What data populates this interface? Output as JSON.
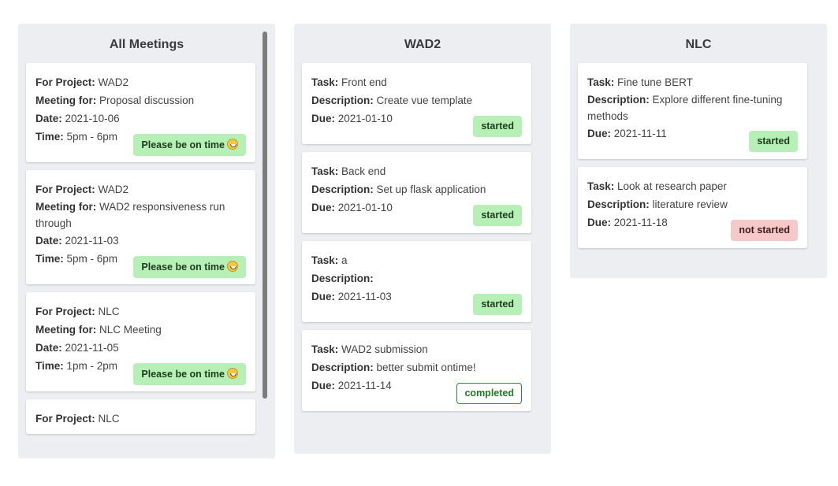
{
  "columns": {
    "meetings": {
      "title": "All Meetings",
      "labels": {
        "project": "For Project:",
        "meeting": "Meeting for:",
        "date": "Date:",
        "time": "Time:"
      },
      "badge_label": "Please be on time",
      "items": [
        {
          "project": "WAD2",
          "meeting": "Proposal discussion",
          "date": "2021-10-06",
          "time": "5pm - 6pm"
        },
        {
          "project": "WAD2",
          "meeting": "WAD2 responsiveness run through",
          "date": "2021-11-03",
          "time": "5pm - 6pm"
        },
        {
          "project": "NLC",
          "meeting": "NLC Meeting",
          "date": "2021-11-05",
          "time": "1pm - 2pm"
        },
        {
          "project": "NLC"
        }
      ]
    },
    "wad2": {
      "title": "WAD2",
      "labels": {
        "task": "Task:",
        "description": "Description:",
        "due": "Due:"
      },
      "items": [
        {
          "task": "Front end",
          "description": "Create vue template",
          "due": "2021-01-10",
          "status": "started"
        },
        {
          "task": "Back end",
          "description": "Set up flask application",
          "due": "2021-01-10",
          "status": "started"
        },
        {
          "task": "a",
          "description": "",
          "due": "2021-11-03",
          "status": "started"
        },
        {
          "task": "WAD2 submission",
          "description": "better submit ontime!",
          "due": "2021-11-14",
          "status": "completed"
        }
      ]
    },
    "nlc": {
      "title": "NLC",
      "labels": {
        "task": "Task:",
        "description": "Description:",
        "due": "Due:"
      },
      "items": [
        {
          "task": "Fine tune BERT",
          "description": "Explore different fine-tuning methods",
          "due": "2021-11-11",
          "status": "started"
        },
        {
          "task": "Look at research paper",
          "description": "literature review",
          "due": "2021-11-18",
          "status": "not started"
        }
      ]
    }
  },
  "colors": {
    "column_bg": "#eceef1",
    "started": "#b7f0b7",
    "not_started": "#f6c8c8",
    "completed_border": "#2f8a2f"
  },
  "icons": {
    "meeting_badge": "grinning-face-emoji"
  }
}
